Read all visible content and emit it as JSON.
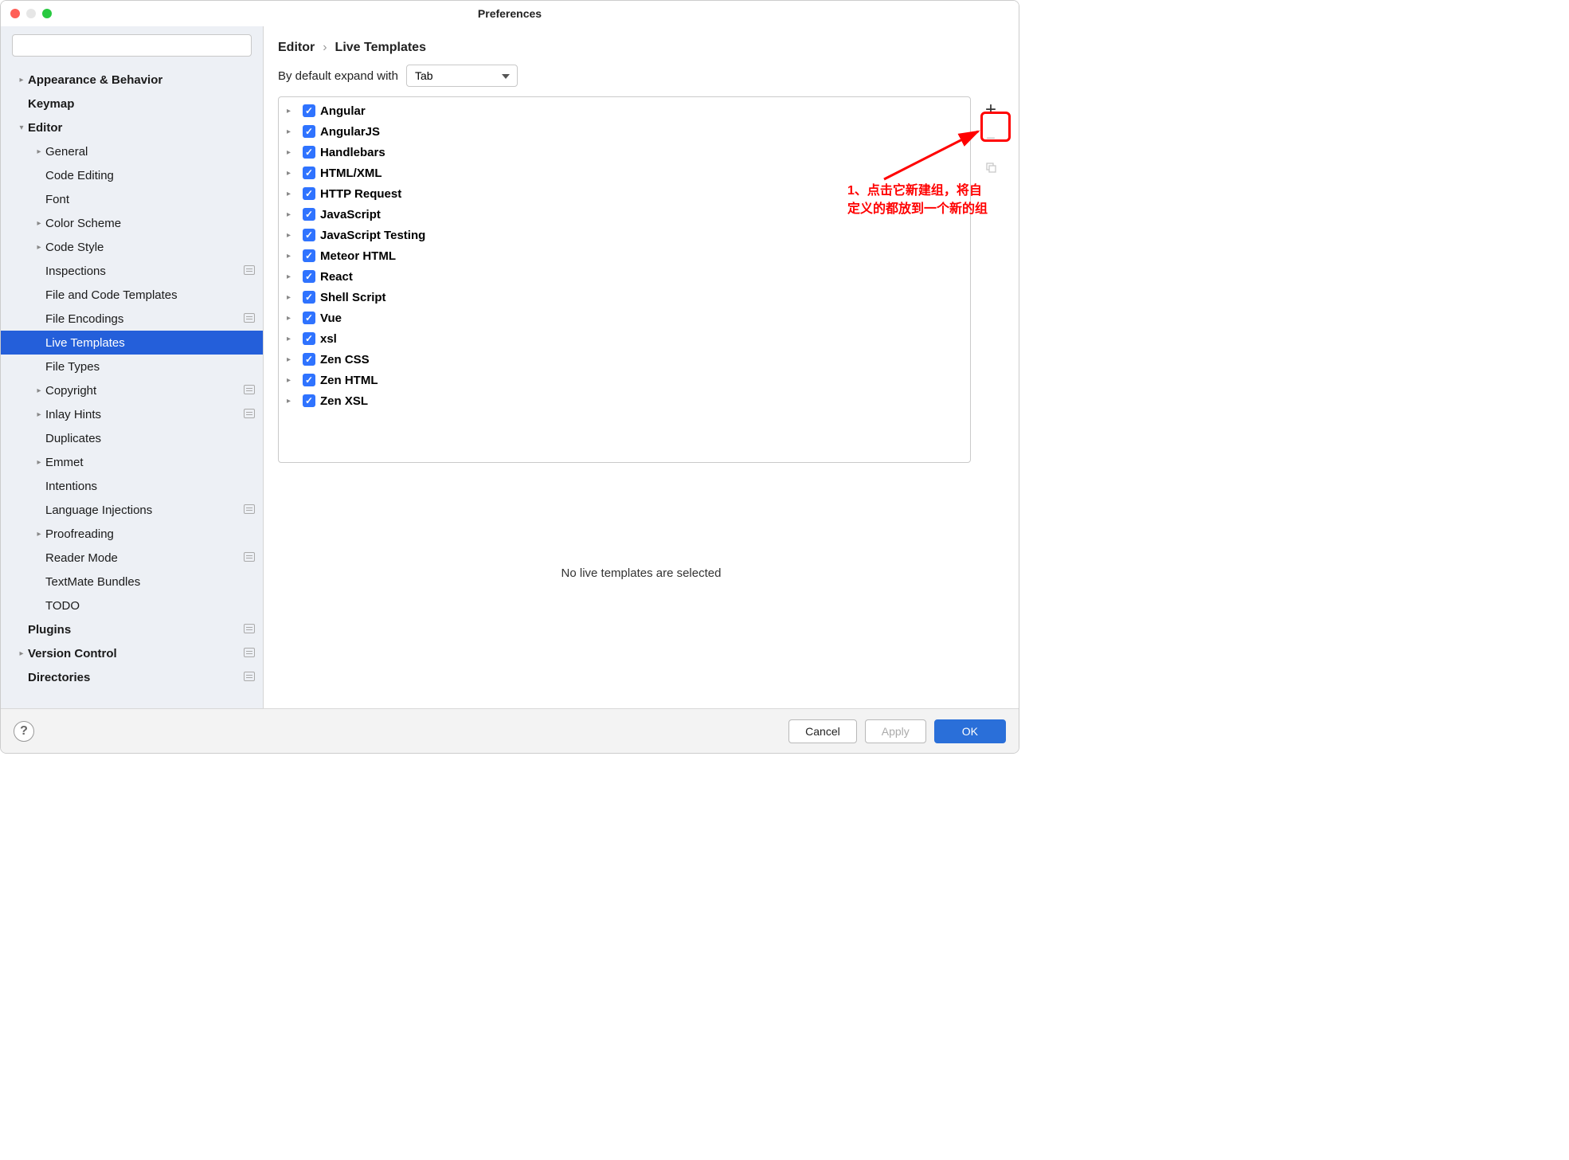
{
  "window": {
    "title": "Preferences"
  },
  "search": {
    "placeholder": ""
  },
  "sidebar": {
    "items": [
      {
        "label": "Appearance & Behavior",
        "indent": 0,
        "bold": true,
        "arrow": "r",
        "badge": false
      },
      {
        "label": "Keymap",
        "indent": 0,
        "bold": true,
        "arrow": "",
        "badge": false
      },
      {
        "label": "Editor",
        "indent": 0,
        "bold": true,
        "arrow": "d",
        "badge": false
      },
      {
        "label": "General",
        "indent": 1,
        "bold": false,
        "arrow": "r",
        "badge": false
      },
      {
        "label": "Code Editing",
        "indent": 1,
        "bold": false,
        "arrow": "",
        "badge": false
      },
      {
        "label": "Font",
        "indent": 1,
        "bold": false,
        "arrow": "",
        "badge": false
      },
      {
        "label": "Color Scheme",
        "indent": 1,
        "bold": false,
        "arrow": "r",
        "badge": false
      },
      {
        "label": "Code Style",
        "indent": 1,
        "bold": false,
        "arrow": "r",
        "badge": false
      },
      {
        "label": "Inspections",
        "indent": 1,
        "bold": false,
        "arrow": "",
        "badge": true
      },
      {
        "label": "File and Code Templates",
        "indent": 1,
        "bold": false,
        "arrow": "",
        "badge": false
      },
      {
        "label": "File Encodings",
        "indent": 1,
        "bold": false,
        "arrow": "",
        "badge": true
      },
      {
        "label": "Live Templates",
        "indent": 1,
        "bold": false,
        "arrow": "",
        "badge": false,
        "selected": true
      },
      {
        "label": "File Types",
        "indent": 1,
        "bold": false,
        "arrow": "",
        "badge": false
      },
      {
        "label": "Copyright",
        "indent": 1,
        "bold": false,
        "arrow": "r",
        "badge": true
      },
      {
        "label": "Inlay Hints",
        "indent": 1,
        "bold": false,
        "arrow": "r",
        "badge": true
      },
      {
        "label": "Duplicates",
        "indent": 1,
        "bold": false,
        "arrow": "",
        "badge": false
      },
      {
        "label": "Emmet",
        "indent": 1,
        "bold": false,
        "arrow": "r",
        "badge": false
      },
      {
        "label": "Intentions",
        "indent": 1,
        "bold": false,
        "arrow": "",
        "badge": false
      },
      {
        "label": "Language Injections",
        "indent": 1,
        "bold": false,
        "arrow": "",
        "badge": true
      },
      {
        "label": "Proofreading",
        "indent": 1,
        "bold": false,
        "arrow": "r",
        "badge": false
      },
      {
        "label": "Reader Mode",
        "indent": 1,
        "bold": false,
        "arrow": "",
        "badge": true
      },
      {
        "label": "TextMate Bundles",
        "indent": 1,
        "bold": false,
        "arrow": "",
        "badge": false
      },
      {
        "label": "TODO",
        "indent": 1,
        "bold": false,
        "arrow": "",
        "badge": false
      },
      {
        "label": "Plugins",
        "indent": 0,
        "bold": true,
        "arrow": "",
        "badge": true
      },
      {
        "label": "Version Control",
        "indent": 0,
        "bold": true,
        "arrow": "r",
        "badge": true
      },
      {
        "label": "Directories",
        "indent": 0,
        "bold": true,
        "arrow": "",
        "badge": true
      }
    ]
  },
  "breadcrumb": {
    "parent": "Editor",
    "sep": "›",
    "current": "Live Templates"
  },
  "expand": {
    "label": "By default expand with",
    "value": "Tab"
  },
  "templates": [
    {
      "name": "Angular"
    },
    {
      "name": "AngularJS"
    },
    {
      "name": "Handlebars"
    },
    {
      "name": "HTML/XML"
    },
    {
      "name": "HTTP Request"
    },
    {
      "name": "JavaScript"
    },
    {
      "name": "JavaScript Testing"
    },
    {
      "name": "Meteor HTML"
    },
    {
      "name": "React"
    },
    {
      "name": "Shell Script"
    },
    {
      "name": "Vue"
    },
    {
      "name": "xsl"
    },
    {
      "name": "Zen CSS"
    },
    {
      "name": "Zen HTML"
    },
    {
      "name": "Zen XSL"
    }
  ],
  "status": "No live templates are selected",
  "footer": {
    "cancel": "Cancel",
    "apply": "Apply",
    "ok": "OK",
    "help": "?"
  },
  "annotation": {
    "text": "1、点击它新建组，将自定义的都放到一个新的组"
  }
}
